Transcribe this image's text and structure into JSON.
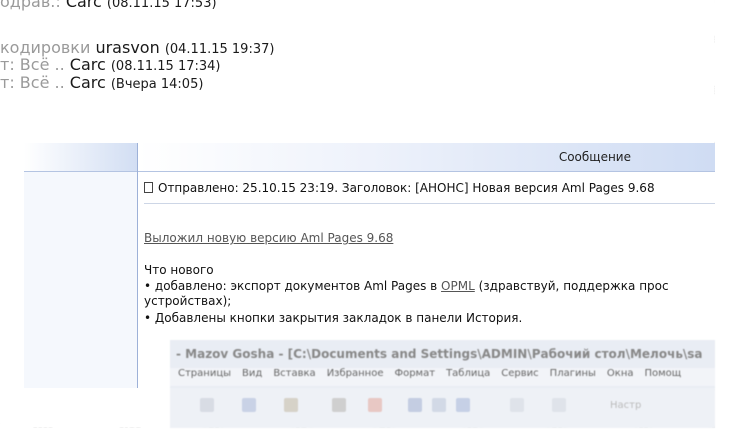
{
  "history_lines": [
    {
      "prefix": "одрав.:",
      "author": "Carc",
      "time": "(08.11.15 17:53)"
    },
    {
      "prefix": "кодировки",
      "author": "urasvon",
      "time": "(04.11.15 19:37)"
    },
    {
      "prefix": "т: Всё ..",
      "author": "Carc",
      "time": "(08.11.15 17:34)"
    },
    {
      "prefix": "т: Всё ..",
      "author": "Carc",
      "time": "(Вчера 14:05)"
    }
  ],
  "table": {
    "message_header": "Сообщение"
  },
  "message": {
    "head": "Отправлено: 25.10.15 23:19. Заголовок: [АНОНС] Новая версия Aml Pages 9.68",
    "link": "Выложил новую версию Aml Pages 9.68",
    "whats_new": "Что нового",
    "bullet1_start": "• добавлено: экспорт документов Aml Pages в ",
    "bullet1_link": "OPML",
    "bullet1_end": " (здравствуй, поддержка прос",
    "bullet1_wrap": "устройствах);",
    "bullet2": "• Добавлены кнопки закрытия закладок в панели История."
  },
  "embedded_window": {
    "title": "- Mazov Gosha - [C:\\Documents and Settings\\ADMIN\\Рабочий стол\\Мелочь\\sa",
    "menu": [
      "Страницы",
      "Вид",
      "Вставка",
      "Избранное",
      "Формат",
      "Таблица",
      "Сервис",
      "Плагины",
      "Окна",
      "Помощ"
    ],
    "toolbar_text": "Настр"
  }
}
